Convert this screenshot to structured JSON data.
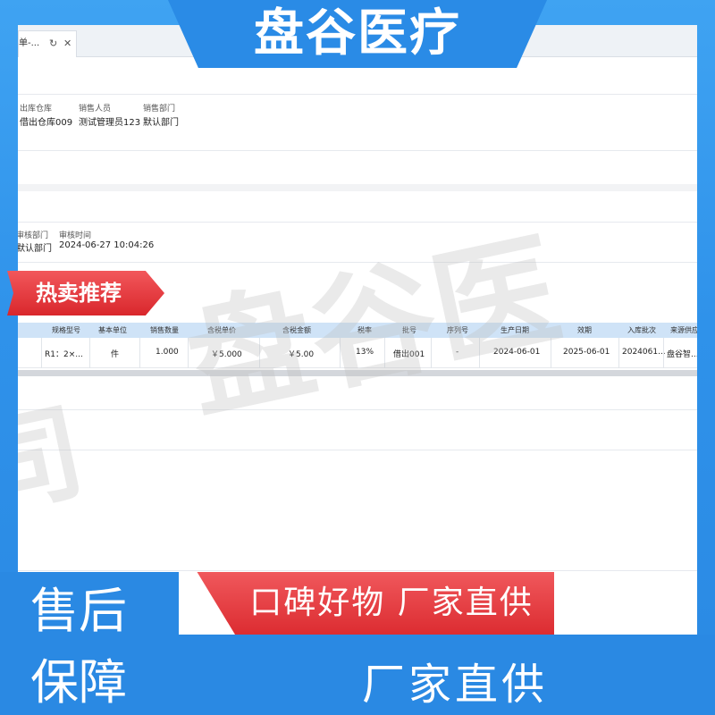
{
  "brand": {
    "title": "盘谷医疗"
  },
  "tab": {
    "title": "单-...",
    "refresh_icon": "refresh-icon",
    "close_icon": "close-icon"
  },
  "info1": [
    {
      "label": "出库仓库",
      "value": "借出仓库009"
    },
    {
      "label": "销售人员",
      "value": "测试管理员123"
    },
    {
      "label": "销售部门",
      "value": "默认部门"
    }
  ],
  "info2": [
    {
      "label": "审核部门",
      "value": "默认部门"
    },
    {
      "label": "审核时间",
      "value": "2024-06-27 10:04:26"
    }
  ],
  "badge": {
    "hot": "热卖推荐"
  },
  "table": {
    "headers": [
      "规格型号",
      "基本单位",
      "销售数量",
      "含税单价",
      "含税金额",
      "税率",
      "批号",
      "序列号",
      "生产日期",
      "效期",
      "入库批次",
      "来源供应"
    ],
    "rows": [
      [
        "R1：2×...",
        "件",
        "1.000",
        "￥5.000",
        "￥5.00",
        "13%",
        "借出001",
        "-",
        "2024-06-01",
        "2025-06-01",
        "2024061...",
        "盘谷智..."
      ]
    ]
  },
  "watermark": {
    "text": "盘谷医",
    "left_fragment": "司"
  },
  "promo": {
    "red_banner": "口碑好物  厂家直供",
    "left_top": "售后",
    "left_bottom": "保障",
    "bottom_right": "厂家直供"
  },
  "colors": {
    "blue": "#2a89e3",
    "red": "#dc2c31",
    "header": "#cfe3f7"
  }
}
